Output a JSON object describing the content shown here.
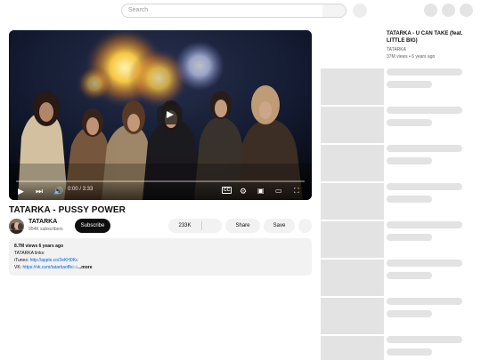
{
  "header": {
    "search_placeholder": "Search"
  },
  "player": {
    "time_label": "0:00 / 3:33",
    "cc_label": "CC",
    "progress_fraction": 0.0
  },
  "video": {
    "title": "TATARKA - PUSSY POWER",
    "channel_name": "TATARKA",
    "subscribers": "954K subscribers",
    "subscribe_label": "Subscribe",
    "likes": "233K",
    "share_label": "Share",
    "save_label": "Save"
  },
  "description": {
    "meta": "8.7M views  6 years ago",
    "line1": "TATARKA links:",
    "itunes_prefix": "iTunes: ",
    "itunes_link": "http://apple.co/2eKH0Kc",
    "vk_prefix": "VK: ",
    "vk_link": "https://vk.com/tatarkaoffic",
    "vk_fade": "ial",
    "more_label": "...more"
  },
  "sidebar": {
    "first": {
      "title": "TATARKA - U CAN TAKE (feat. LITTLE BIG)",
      "channel": "TATARKA",
      "meta": "37M views  • 6 years ago"
    }
  }
}
